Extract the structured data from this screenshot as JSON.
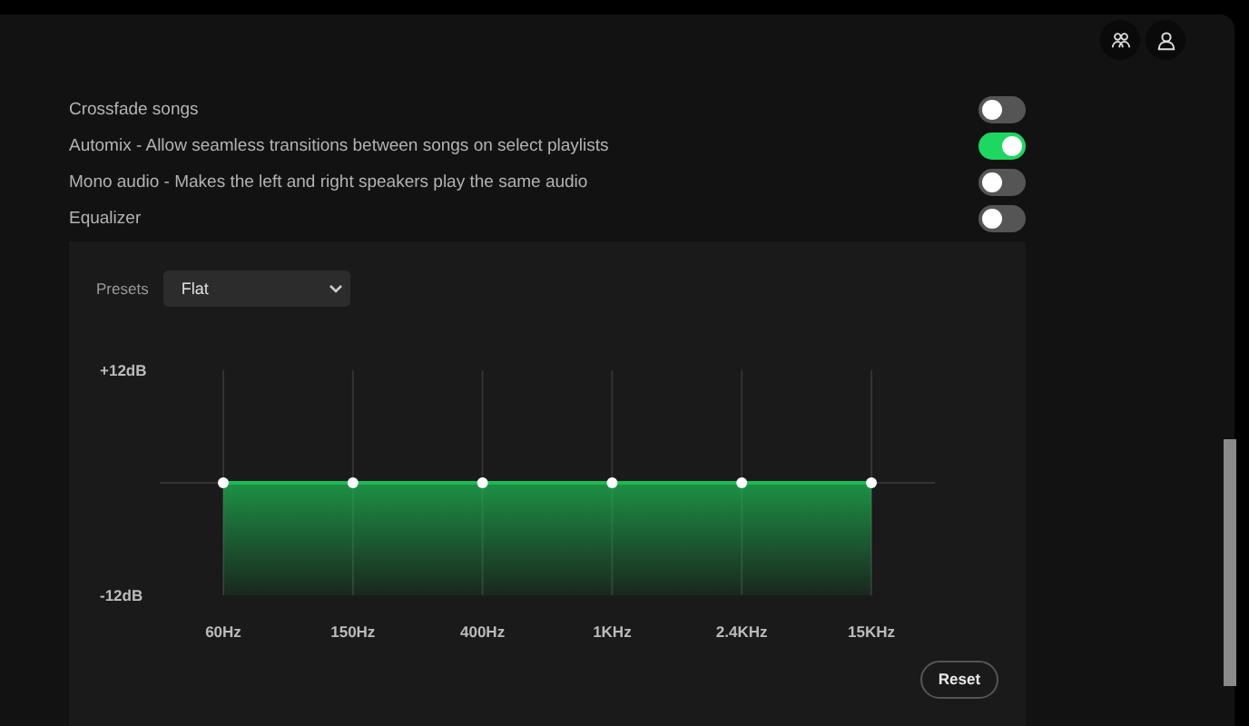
{
  "settings": [
    {
      "label": "Crossfade songs",
      "on": false
    },
    {
      "label": "Automix - Allow seamless transitions between songs on select playlists",
      "on": true
    },
    {
      "label": "Mono audio - Makes the left and right speakers play the same audio",
      "on": false
    },
    {
      "label": "Equalizer",
      "on": false
    }
  ],
  "equalizer": {
    "presets_label": "Presets",
    "preset": "Flat",
    "chart_data": {
      "type": "line",
      "grid": true,
      "categories": [
        "60Hz",
        "150Hz",
        "400Hz",
        "1KHz",
        "2.4KHz",
        "15KHz"
      ],
      "series": [
        {
          "color": "#1db954",
          "marker": "circle",
          "values": [
            0,
            0,
            0,
            0,
            0,
            0
          ]
        }
      ],
      "ylim": [
        -12,
        12
      ],
      "yticks": [
        {
          "value": 12,
          "label": "+12dB"
        },
        {
          "value": -12,
          "label": "-12dB"
        }
      ]
    },
    "reset": "Reset"
  }
}
